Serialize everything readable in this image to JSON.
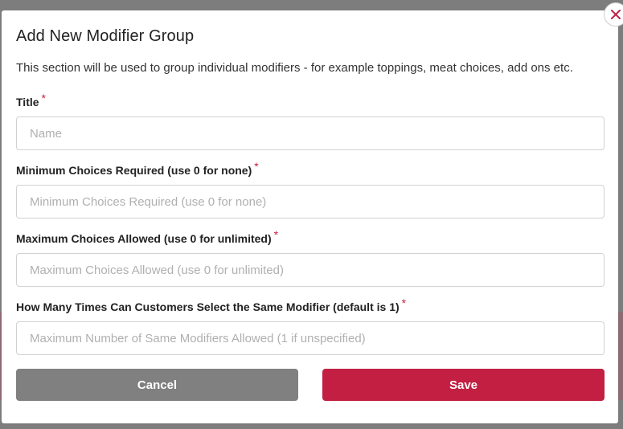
{
  "modal": {
    "title": "Add New Modifier Group",
    "description": "This section will be used to group individual modifiers - for example toppings, meat choices, add ons etc."
  },
  "fields": [
    {
      "label": "Title",
      "required_mark": "*",
      "placeholder": "Name",
      "value": ""
    },
    {
      "label": "Minimum Choices Required (use 0 for none)",
      "required_mark": "*",
      "placeholder": "Minimum Choices Required (use 0 for none)",
      "value": ""
    },
    {
      "label": "Maximum Choices Allowed (use 0 for unlimited)",
      "required_mark": "*",
      "placeholder": "Maximum Choices Allowed (use 0 for unlimited)",
      "value": ""
    },
    {
      "label": "How Many Times Can Customers Select the Same Modifier (default is 1)",
      "required_mark": "*",
      "placeholder": "Maximum Number of Same Modifiers Allowed (1 if unspecified)",
      "value": ""
    }
  ],
  "buttons": {
    "cancel_label": "Cancel",
    "save_label": "Save"
  },
  "icons": {
    "close": "close-icon"
  },
  "colors": {
    "accent": "#c21f43",
    "cancel": "#808080",
    "required": "#c8203f"
  }
}
